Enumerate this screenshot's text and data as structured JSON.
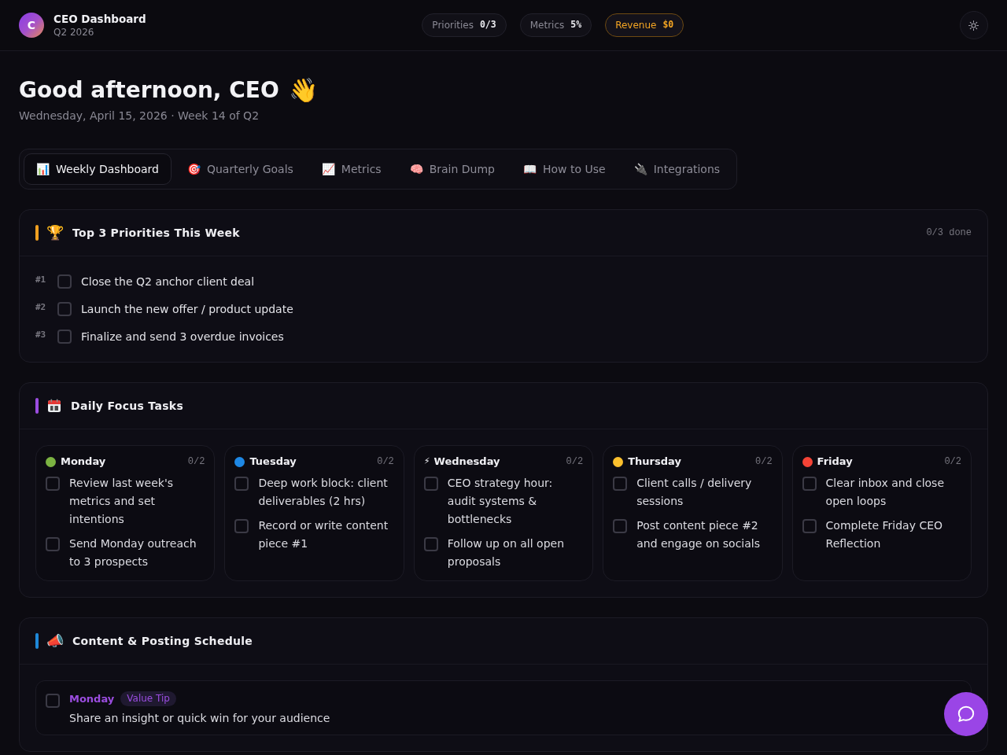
{
  "header": {
    "logo_letter": "C",
    "title": "CEO Dashboard",
    "subtitle": "Q2 2026",
    "stats": [
      {
        "label": "Priorities",
        "value": "0/3",
        "highlighted": false
      },
      {
        "label": "Metrics",
        "value": "5%",
        "highlighted": false
      },
      {
        "label": "Revenue",
        "value": "$0",
        "highlighted": true
      }
    ]
  },
  "greeting": {
    "title": "Good afternoon, CEO",
    "emoji": "👋",
    "subtitle": "Wednesday, April 15, 2026 · Week 14 of Q2"
  },
  "tabs": [
    {
      "icon": "📊",
      "label": "Weekly Dashboard",
      "selected": true
    },
    {
      "icon": "🎯",
      "label": "Quarterly Goals",
      "selected": false
    },
    {
      "icon": "📈",
      "label": "Metrics",
      "selected": false
    },
    {
      "icon": "🧠",
      "label": "Brain Dump",
      "selected": false
    },
    {
      "icon": "📖",
      "label": "How to Use",
      "selected": false
    },
    {
      "icon": "🔌",
      "label": "Integrations",
      "selected": false
    }
  ],
  "sections": [
    {
      "kind": "priorities",
      "color": "#f0a020",
      "icon": "🏆",
      "title": "Top 3 Priorities This Week",
      "summary": "0/3 done",
      "items": [
        {
          "number": "#1",
          "text": "Close the Q2 anchor client deal",
          "checked": false
        },
        {
          "number": "#2",
          "text": "Launch the new offer / product update",
          "checked": false
        },
        {
          "number": "#3",
          "text": "Finalize and send 3 overdue invoices",
          "checked": false
        }
      ]
    },
    {
      "kind": "days",
      "color": "#9b4de0",
      "title": "Daily Focus Tasks",
      "days": [
        {
          "kind": "dot",
          "color": "#7cb342",
          "name": "Monday",
          "count": "0/2",
          "tasks": [
            {
              "text": "Review last week's metrics and set intentions",
              "checked": false
            },
            {
              "text": "Send Monday outreach to 3 prospects",
              "checked": false
            }
          ]
        },
        {
          "kind": "dot",
          "color": "#1e88e5",
          "name": "Tuesday",
          "count": "0/2",
          "tasks": [
            {
              "text": "Deep work block: client deliverables (2 hrs)",
              "checked": false
            },
            {
              "text": "Record or write content piece #1",
              "checked": false
            }
          ]
        },
        {
          "kind": "symbol",
          "symbol": "⚡",
          "name": "Wednesday",
          "count": "0/2",
          "tasks": [
            {
              "text": "CEO strategy hour: audit systems & bottlenecks",
              "checked": false
            },
            {
              "text": "Follow up on all open proposals",
              "checked": false
            }
          ]
        },
        {
          "kind": "dot",
          "color": "#fbc02d",
          "name": "Thursday",
          "count": "0/2",
          "tasks": [
            {
              "text": "Client calls / delivery sessions",
              "checked": false
            },
            {
              "text": "Post content piece #2 and engage on socials",
              "checked": false
            }
          ]
        },
        {
          "kind": "dot",
          "color": "#f44336",
          "name": "Friday",
          "count": "0/2",
          "tasks": [
            {
              "text": "Clear inbox and close open loops",
              "checked": false
            },
            {
              "text": "Complete Friday CEO Reflection",
              "checked": false
            }
          ]
        }
      ]
    },
    {
      "kind": "schedule",
      "color": "#1e88d8",
      "icon": "📣",
      "title": "Content & Posting Schedule",
      "posts": [
        {
          "day": "Monday",
          "color": "#9b4de0",
          "tag": "Value Tip",
          "text": "Share an insight or quick win for your audience",
          "checked": false
        }
      ]
    }
  ]
}
